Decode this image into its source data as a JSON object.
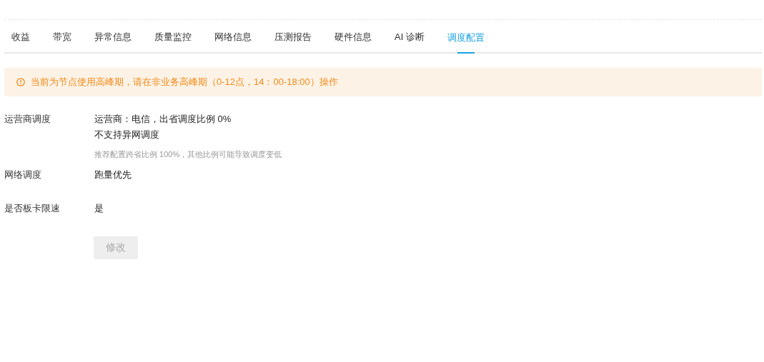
{
  "tabs": [
    {
      "label": "收益",
      "selected": false
    },
    {
      "label": "带宽",
      "selected": false
    },
    {
      "label": "异常信息",
      "selected": false
    },
    {
      "label": "质量监控",
      "selected": false
    },
    {
      "label": "网络信息",
      "selected": false
    },
    {
      "label": "压测报告",
      "selected": false
    },
    {
      "label": "硬件信息",
      "selected": false
    },
    {
      "label": "AI 诊断",
      "selected": false
    },
    {
      "label": "调度配置",
      "selected": true
    }
  ],
  "alert": {
    "text": "当前为节点使用高峰期，请在非业务高峰期（0-12点，14：00-18:00）操作"
  },
  "fields": [
    {
      "label": "运营商调度",
      "lines": [
        "运营商：电信，出省调度比例 0%",
        "不支持异网调度"
      ],
      "hint": "推荐配置跨省比例 100%，其他比例可能导致调度变低"
    },
    {
      "label": "网络调度",
      "lines": [
        "跑量优先"
      ]
    },
    {
      "label": "是否板卡限速",
      "lines": [
        "是"
      ]
    }
  ],
  "edit_button": {
    "label": "修改",
    "disabled": true
  }
}
